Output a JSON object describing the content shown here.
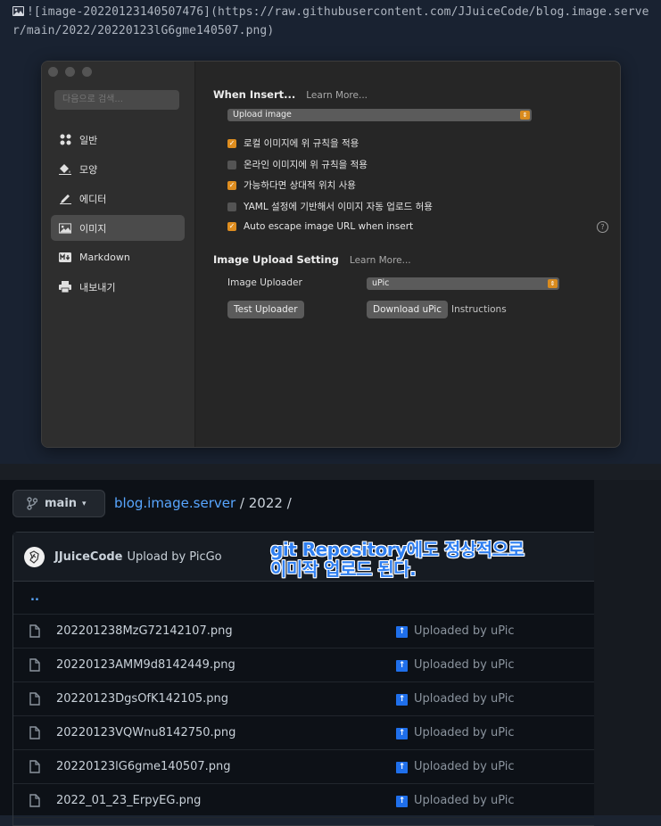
{
  "markdown": {
    "text": "![image-20220123140507476](https://raw.githubusercontent.com/JJuiceCode/blog.image.server/main/2022/20220123lG6gme140507.png)",
    "icon": "image-icon"
  },
  "prefs": {
    "search_placeholder": "다음으로 검색...",
    "nav": [
      {
        "label": "일반",
        "icon": "grid-icon"
      },
      {
        "label": "모양",
        "icon": "paint-bucket-icon"
      },
      {
        "label": "에디터",
        "icon": "pencil-icon"
      },
      {
        "label": "이미지",
        "icon": "image-icon",
        "active": true
      },
      {
        "label": "Markdown",
        "icon": "markdown-icon"
      },
      {
        "label": "내보내기",
        "icon": "printer-icon"
      }
    ],
    "when_insert": {
      "title": "When Insert...",
      "learn_more": "Learn More...",
      "select_value": "Upload image",
      "options": [
        {
          "label": "로컬 이미지에 위 규칙을 적용",
          "checked": true
        },
        {
          "label": "온라인 이미지에 위 규칙을 적용",
          "checked": false
        },
        {
          "label": "가능하다면 상대적 위치 사용",
          "checked": true
        },
        {
          "label": "YAML 설정에 기반해서 이미지 자동 업로드 허용",
          "checked": false
        },
        {
          "label": "Auto escape image URL when insert",
          "checked": true
        }
      ],
      "help": "?"
    },
    "upload_setting": {
      "title": "Image Upload Setting",
      "learn_more": "Learn More...",
      "uploader_label": "Image Uploader",
      "uploader_value": "uPic",
      "test_button": "Test Uploader",
      "download_button": "Download uPic",
      "instructions": "Instructions"
    }
  },
  "github": {
    "branch": "main",
    "breadcrumb": {
      "repo": "blog.image.server",
      "sep1": " / ",
      "folder": "2022",
      "sep2": " /"
    },
    "commit": {
      "author": "JJuiceCode",
      "message": "Upload by PicGo"
    },
    "parent": "..",
    "files": [
      {
        "name": "202201238MzG72142107.png",
        "commit": "Uploaded by uPic"
      },
      {
        "name": "20220123AMM9d8142449.png",
        "commit": "Uploaded by uPic"
      },
      {
        "name": "20220123DgsOfK142105.png",
        "commit": "Uploaded by uPic"
      },
      {
        "name": "20220123VQWnu8142750.png",
        "commit": "Uploaded by uPic"
      },
      {
        "name": "20220123lG6gme140507.png",
        "commit": "Uploaded by uPic"
      },
      {
        "name": "2022_01_23_ErpyEG.png",
        "commit": "Uploaded by uPic"
      }
    ],
    "annotation": [
      "git Repository에도 정상적으로",
      "이미작 업로드 된다."
    ]
  }
}
